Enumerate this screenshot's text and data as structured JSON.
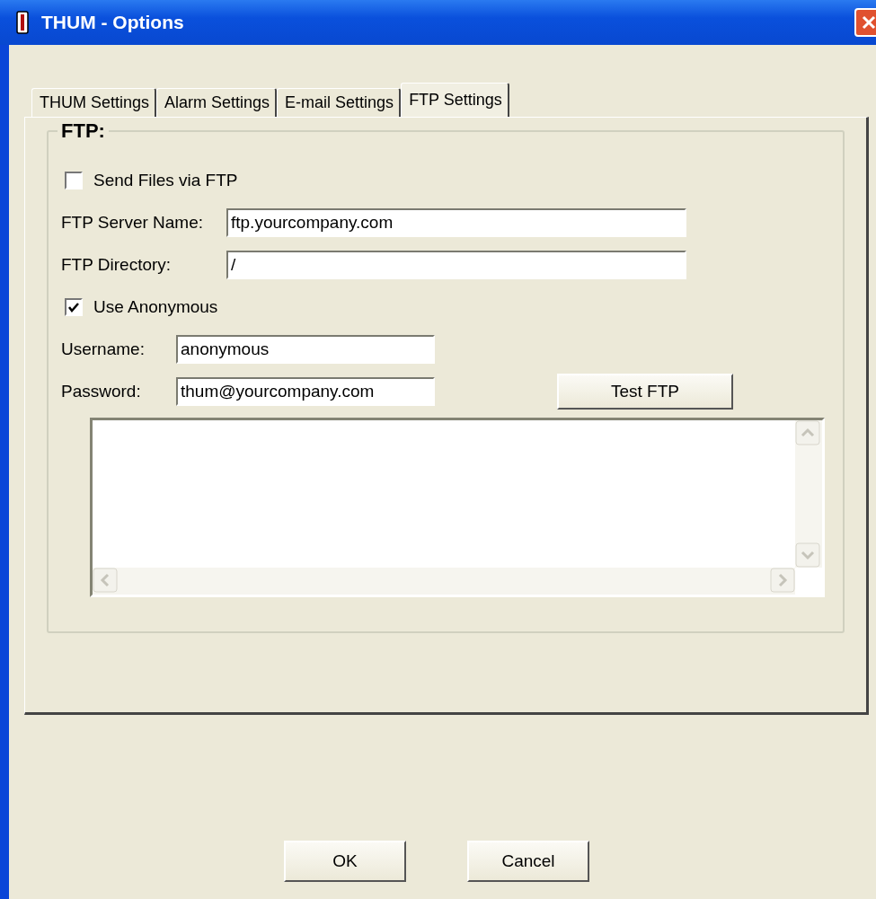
{
  "window": {
    "title": "THUM - Options"
  },
  "tabs": [
    {
      "label": "THUM Settings",
      "selected": false
    },
    {
      "label": "Alarm Settings",
      "selected": false
    },
    {
      "label": "E-mail Settings",
      "selected": false
    },
    {
      "label": "FTP Settings",
      "selected": true
    }
  ],
  "group": {
    "title": "FTP:"
  },
  "send_files": {
    "label": "Send Files via FTP",
    "checked": false
  },
  "server": {
    "label": "FTP Server Name:",
    "value": "ftp.yourcompany.com"
  },
  "directory": {
    "label": "FTP Directory:",
    "value": "/"
  },
  "anonymous": {
    "label": "Use Anonymous",
    "checked": true
  },
  "username": {
    "label": "Username:",
    "value": "anonymous"
  },
  "password": {
    "label": "Password:",
    "value": "thum@yourcompany.com"
  },
  "test_button": "Test FTP",
  "buttons": [
    "OK",
    "Cancel"
  ]
}
